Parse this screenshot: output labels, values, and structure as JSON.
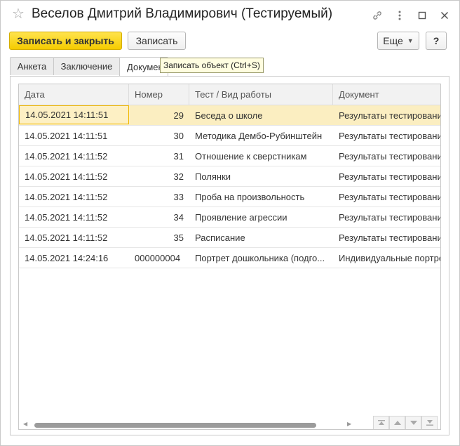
{
  "window": {
    "title": "Веселов Дмитрий Владимирович (Тестируемый)"
  },
  "toolbar": {
    "save_close_label": "Записать и закрыть",
    "save_label": "Записать",
    "more_label": "Еще",
    "help_label": "?"
  },
  "tabs": [
    {
      "label": "Анкета"
    },
    {
      "label": "Заключение"
    },
    {
      "label": "Документы"
    }
  ],
  "tooltip": {
    "text": "Записать объект (Ctrl+S)"
  },
  "grid": {
    "columns": [
      "Дата",
      "Номер",
      "Тест / Вид работы",
      "Документ"
    ],
    "rows": [
      {
        "date": "14.05.2021 14:11:51",
        "number": "29",
        "test": "Беседа о школе",
        "document": "Результаты тестировани",
        "selected": true
      },
      {
        "date": "14.05.2021 14:11:51",
        "number": "30",
        "test": "Методика Дембо-Рубинштейн",
        "document": "Результаты тестировани",
        "selected": false
      },
      {
        "date": "14.05.2021 14:11:52",
        "number": "31",
        "test": "Отношение к сверстникам",
        "document": "Результаты тестировани",
        "selected": false
      },
      {
        "date": "14.05.2021 14:11:52",
        "number": "32",
        "test": "Полянки",
        "document": "Результаты тестировани",
        "selected": false
      },
      {
        "date": "14.05.2021 14:11:52",
        "number": "33",
        "test": "Проба на произвольность",
        "document": "Результаты тестировани",
        "selected": false
      },
      {
        "date": "14.05.2021 14:11:52",
        "number": "34",
        "test": "Проявление агрессии",
        "document": "Результаты тестировани",
        "selected": false
      },
      {
        "date": "14.05.2021 14:11:52",
        "number": "35",
        "test": "Расписание",
        "document": "Результаты тестировани",
        "selected": false
      },
      {
        "date": "14.05.2021 14:24:16",
        "number": "000000004",
        "test": "Портрет дошкольника (подго...",
        "document": "Индивидуальные портре",
        "selected": false
      }
    ]
  },
  "colors": {
    "primary_button": "#f5cc00",
    "selected_row": "#fbeec1",
    "tooltip_bg": "#fffde0"
  },
  "icons": {
    "favorite": "star-icon",
    "link": "link-icon",
    "menu": "more-vertical-icon",
    "maximize": "maximize-icon",
    "close": "close-icon"
  }
}
